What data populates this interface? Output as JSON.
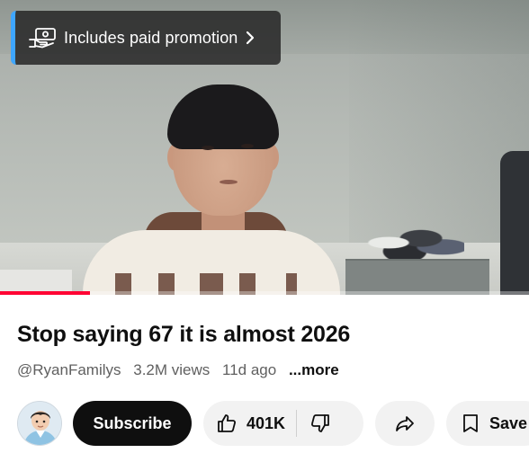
{
  "promo": {
    "label": "Includes paid promotion",
    "icon": "paid-promotion-icon",
    "accent": "#3ea6ff"
  },
  "video": {
    "progress_fraction": 0.17,
    "progress_color": "#ff0033"
  },
  "details": {
    "title": "Stop saying 67 it is almost 2026",
    "channel_handle": "@RyanFamilys",
    "views": "3.2M views",
    "age": "11d ago",
    "more_label": "...more"
  },
  "actions": {
    "subscribe_label": "Subscribe",
    "like_count": "401K",
    "save_label": "Save",
    "icons": [
      "thumbs-up-icon",
      "thumbs-down-icon",
      "share-icon",
      "bookmark-icon"
    ]
  }
}
